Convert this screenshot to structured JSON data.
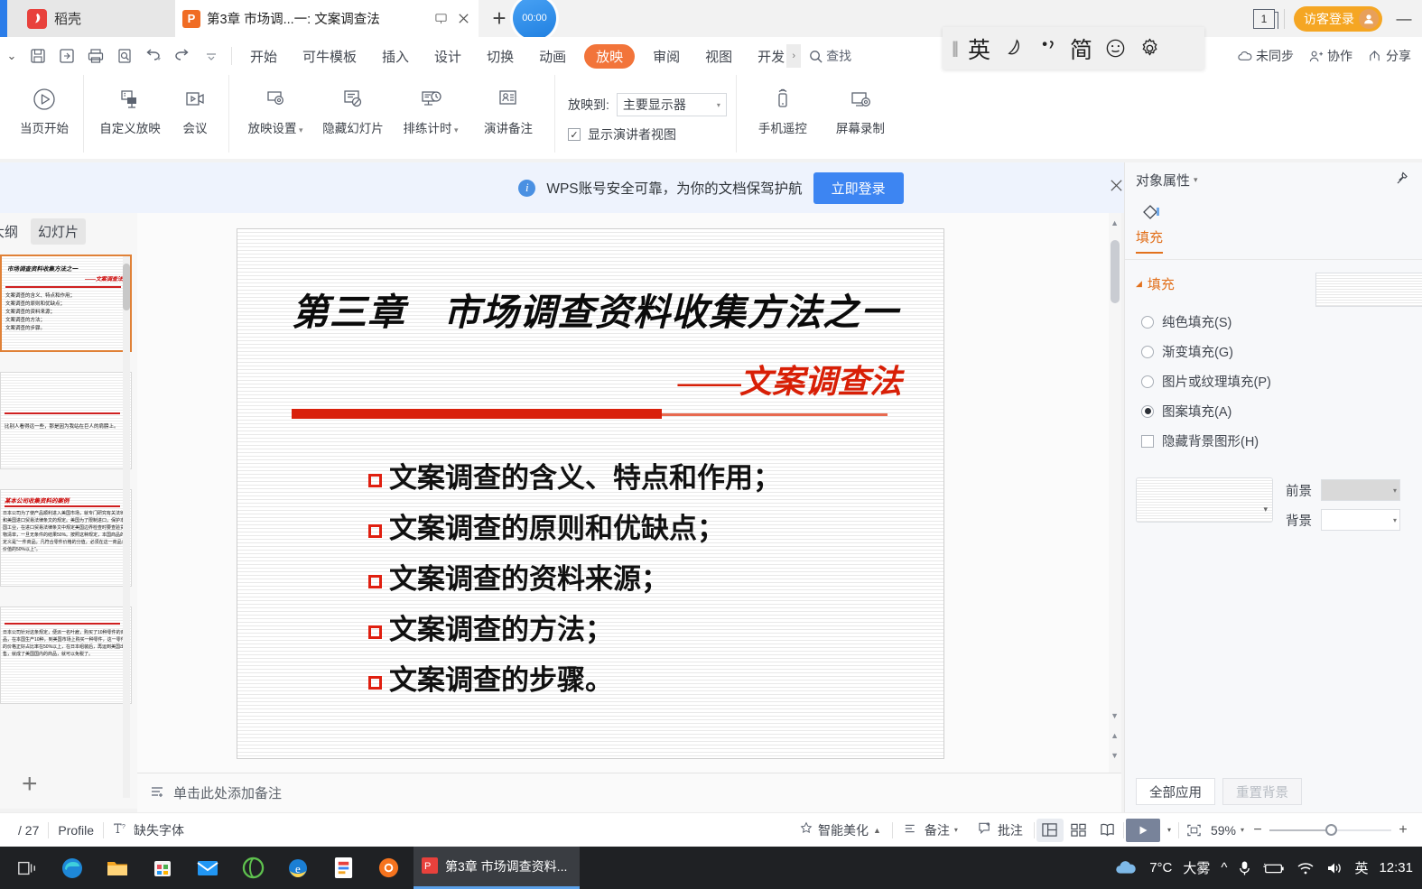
{
  "titlebar": {
    "daoke_label": "稻壳",
    "daoke_icon": "wps-daoke-icon",
    "doc_tab_title": "第3章 市场调...一: 文案调查法",
    "new_tab_plus": "+",
    "timer_label": "00:00",
    "page_count": "1",
    "login_label": "访客登录",
    "minimize": "—"
  },
  "menurow": {
    "quick_access": [
      "save-icon",
      "save-as-icon",
      "print-icon",
      "print-preview-icon",
      "undo-icon",
      "redo-icon",
      "customize-icon"
    ],
    "tabs": [
      {
        "label": "开始",
        "active": false
      },
      {
        "label": "可牛模板",
        "active": false
      },
      {
        "label": "插入",
        "active": false
      },
      {
        "label": "设计",
        "active": false
      },
      {
        "label": "切换",
        "active": false
      },
      {
        "label": "动画",
        "active": false
      },
      {
        "label": "放映",
        "active": true
      },
      {
        "label": "审阅",
        "active": false
      },
      {
        "label": "视图",
        "active": false
      },
      {
        "label": "开发工具",
        "active": false
      }
    ],
    "search_placeholder": "查找",
    "right_items": [
      {
        "label": "未同步",
        "icon": "cloud-sync-icon"
      },
      {
        "label": "协作",
        "icon": "collaborate-icon"
      },
      {
        "label": "分享",
        "icon": "share-icon"
      }
    ]
  },
  "ribbon": {
    "groups": [
      {
        "buttons": [
          {
            "label": "当页开始",
            "icon": "play-circle-icon",
            "dropdown": false
          }
        ]
      },
      {
        "buttons": [
          {
            "label": "自定义放映",
            "icon": "custom-show-icon",
            "dropdown": false
          },
          {
            "label": "会议",
            "icon": "meeting-icon",
            "dropdown": false
          }
        ]
      },
      {
        "buttons": [
          {
            "label": "放映设置",
            "icon": "show-settings-icon",
            "dropdown": true
          },
          {
            "label": "隐藏幻灯片",
            "icon": "hide-slide-icon",
            "dropdown": false
          },
          {
            "label": "排练计时",
            "icon": "rehearse-timing-icon",
            "dropdown": true
          },
          {
            "label": "演讲备注",
            "icon": "speaker-notes-icon",
            "dropdown": false
          }
        ]
      }
    ],
    "projection": {
      "label": "放映到:",
      "select_value": "主要显示器",
      "checkbox_label": "显示演讲者视图",
      "checkbox_checked": true
    },
    "right_buttons": [
      {
        "label": "手机遥控",
        "icon": "phone-remote-icon"
      },
      {
        "label": "屏幕录制",
        "icon": "screen-record-icon"
      }
    ]
  },
  "banner": {
    "icon": "info-icon",
    "text": "WPS账号安全可靠，为你的文档保驾护航",
    "button_label": "立即登录",
    "close_icon": "close-icon"
  },
  "left_panel": {
    "tabs": [
      {
        "label": "大纲",
        "selected": false
      },
      {
        "label": "幻灯片",
        "selected": true
      }
    ],
    "thumbnails": [
      {
        "index": 1,
        "current": true,
        "title": "市场调查资料收集方法之一",
        "subtitle": "——文案调查法",
        "lines": [
          "文案调查的含义、特点和作用；",
          "文案调查的原则和优缺点；",
          "文案调查的资料来源；",
          "文案调查的方法；",
          "文案调查的步骤。"
        ]
      },
      {
        "index": 2,
        "current": false,
        "body": "比别人看得远一些，那是因为我站在巨人的肩膀上。"
      },
      {
        "index": 3,
        "current": false,
        "title": "某本公司收集资料的案例",
        "body": "日本公司为了使产品顺利进入美国市场，就专门研究有关法律和美国进口贸易法律条文的规定。美国为了限制进口，保护本国工业，在进口贸易法律条文中规定美国边界检查时要查验货物清单，一旦无条件的结果50%。按照这种规定，本国商品的定义是“一件商品，凡符合零件价格的分值，必须在这一商品总价值的50%以上”。"
      },
      {
        "index": 4,
        "current": false,
        "body": "日本公司针对这条规定，便派一名叶雇，购买了10种零件的商品，在本国生产10种，到美国市场上购买一种零件，这一零件的价格正好占比率在50%以上，在日本组装后，再运到美国出售，就成了美国国内的商品，就可以免税了。"
      }
    ],
    "add_slide_icon": "plus-icon"
  },
  "slide": {
    "title": "第三章　市场调查资料收集方法之一",
    "subtitle_dash": "——",
    "subtitle_text": "文案调查法",
    "bullets": [
      "文案调查的含义、特点和作用；",
      "文案调查的原则和优缺点；",
      "文案调查的资料来源；",
      "文案调查的方法；",
      "文案调查的步骤。"
    ],
    "accent_color": "#d9200b",
    "title_color": "#0b0b0b",
    "bullet_color": "#e01f10"
  },
  "notes": {
    "icon": "add-note-icon",
    "placeholder": "单击此处添加备注"
  },
  "statusbar": {
    "slide_counter": "/ 27",
    "profile_label": "Profile",
    "missing_font_label": "缺失字体",
    "missing_font_icon": "font-missing-icon",
    "beautify_label": "智能美化",
    "beautify_icon": "beautify-icon",
    "notes_label": "备注",
    "notes_icon": "notes-icon",
    "comment_label": "批注",
    "comment_icon": "comment-icon",
    "views": [
      {
        "icon": "normal-view-icon",
        "active": true
      },
      {
        "icon": "slide-sorter-icon",
        "active": false
      },
      {
        "icon": "reading-view-icon",
        "active": false
      }
    ],
    "play_icon": "play-icon",
    "fit_icon": "fit-to-window-icon",
    "zoom_level": "59%",
    "zoom_minus": "−",
    "zoom_plus": "+"
  },
  "right_panel": {
    "header_title": "对象属性",
    "pin_icon": "pin-icon",
    "tab_icon": "fill-shape-icon",
    "tab_label": "填充",
    "section_title": "填充",
    "options": [
      {
        "label": "纯色填充(S)",
        "type": "radio",
        "checked": false
      },
      {
        "label": "渐变填充(G)",
        "type": "radio",
        "checked": false
      },
      {
        "label": "图片或纹理填充(P)",
        "type": "radio",
        "checked": false
      },
      {
        "label": "图案填充(A)",
        "type": "radio",
        "checked": true
      },
      {
        "label": "隐藏背景图形(H)",
        "type": "checkbox",
        "checked": false
      }
    ],
    "foreground_label": "前景",
    "background_label": "背景",
    "foreground_color": "#d9d9d9",
    "background_color": "#ffffff",
    "apply_all_label": "全部应用",
    "reset_bg_label": "重置背景",
    "accent_color": "#e2711d"
  },
  "ime_bar": {
    "items": [
      {
        "icon": "ime-lang-english",
        "glyph": "英"
      },
      {
        "icon": "ime-moon-icon",
        "glyph": "☽"
      },
      {
        "icon": "ime-punctuation-icon",
        "glyph": "•,"
      },
      {
        "icon": "ime-simplified-icon",
        "glyph": "简"
      },
      {
        "icon": "ime-emoji-icon",
        "glyph": "☺"
      },
      {
        "icon": "ime-settings-icon",
        "glyph": "⚙"
      }
    ]
  },
  "taskbar": {
    "icons": [
      {
        "name": "task-view-icon"
      },
      {
        "name": "edge-icon"
      },
      {
        "name": "file-explorer-icon"
      },
      {
        "name": "microsoft-store-icon"
      },
      {
        "name": "mail-icon"
      },
      {
        "name": "browser-green-icon"
      },
      {
        "name": "internet-explorer-icon"
      },
      {
        "name": "wps-office-icon"
      },
      {
        "name": "sogou-icon"
      }
    ],
    "active_app": {
      "label": "第3章 市场调查资料...",
      "icon": "wps-presentation-icon"
    },
    "tray": {
      "weather_icon": "cloud-icon",
      "temperature": "7°C",
      "weather_text": "大雾",
      "chevron": "^",
      "mic_icon": "microphone-icon",
      "battery_icon": "battery-icon",
      "wifi_icon": "wifi-icon",
      "volume_icon": "volume-icon",
      "ime_label": "英",
      "time": "12:31"
    }
  }
}
